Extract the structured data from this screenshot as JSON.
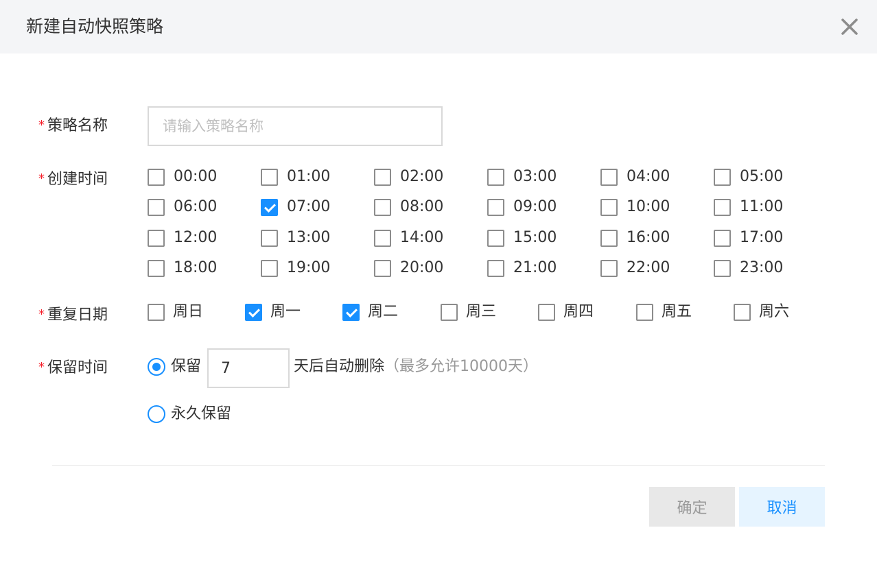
{
  "dialog": {
    "title": "新建自动快照策略",
    "close_icon": "close-icon"
  },
  "form": {
    "policy_name": {
      "required_mark": "*",
      "label": "策略名称",
      "value": "",
      "placeholder": "请输入策略名称"
    },
    "create_time": {
      "required_mark": "*",
      "label": "创建时间",
      "options": [
        {
          "label": "00:00",
          "checked": false
        },
        {
          "label": "01:00",
          "checked": false
        },
        {
          "label": "02:00",
          "checked": false
        },
        {
          "label": "03:00",
          "checked": false
        },
        {
          "label": "04:00",
          "checked": false
        },
        {
          "label": "05:00",
          "checked": false
        },
        {
          "label": "06:00",
          "checked": false
        },
        {
          "label": "07:00",
          "checked": true
        },
        {
          "label": "08:00",
          "checked": false
        },
        {
          "label": "09:00",
          "checked": false
        },
        {
          "label": "10:00",
          "checked": false
        },
        {
          "label": "11:00",
          "checked": false
        },
        {
          "label": "12:00",
          "checked": false
        },
        {
          "label": "13:00",
          "checked": false
        },
        {
          "label": "14:00",
          "checked": false
        },
        {
          "label": "15:00",
          "checked": false
        },
        {
          "label": "16:00",
          "checked": false
        },
        {
          "label": "17:00",
          "checked": false
        },
        {
          "label": "18:00",
          "checked": false
        },
        {
          "label": "19:00",
          "checked": false
        },
        {
          "label": "20:00",
          "checked": false
        },
        {
          "label": "21:00",
          "checked": false
        },
        {
          "label": "22:00",
          "checked": false
        },
        {
          "label": "23:00",
          "checked": false
        }
      ]
    },
    "repeat_days": {
      "required_mark": "*",
      "label": "重复日期",
      "options": [
        {
          "label": "周日",
          "checked": false
        },
        {
          "label": "周一",
          "checked": true
        },
        {
          "label": "周二",
          "checked": true
        },
        {
          "label": "周三",
          "checked": false
        },
        {
          "label": "周四",
          "checked": false
        },
        {
          "label": "周五",
          "checked": false
        },
        {
          "label": "周六",
          "checked": false
        }
      ]
    },
    "retention": {
      "required_mark": "*",
      "label": "保留时间",
      "keep_label": "保留",
      "keep_selected": true,
      "days_value": "7",
      "after_text": "天后自动删除",
      "hint": "（最多允许10000天）",
      "forever_label": "永久保留",
      "forever_selected": false
    }
  },
  "footer": {
    "ok_label": "确定",
    "cancel_label": "取消"
  },
  "colors": {
    "accent": "#1890ff",
    "required": "#f5222d",
    "header_bg": "#f4f5f7",
    "ok_bg": "#e8e8e8",
    "cancel_bg": "#e6f4ff"
  }
}
